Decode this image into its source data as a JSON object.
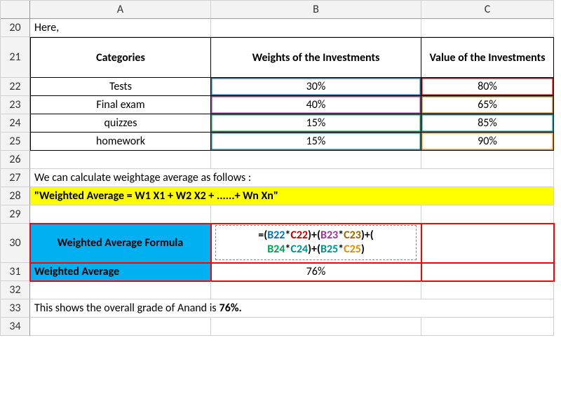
{
  "cols": [
    "",
    "A",
    "B",
    "C"
  ],
  "rows": [
    "20",
    "21",
    "22",
    "23",
    "24",
    "25",
    "26",
    "27",
    "28",
    "29",
    "30",
    "31",
    "32",
    "33",
    "34"
  ],
  "r20": {
    "a": "Here,"
  },
  "r21": {
    "a": "Categories",
    "b": "Weights of the Investments",
    "c": "Value of the Investments"
  },
  "data_rows": [
    {
      "cat": "Tests",
      "w": "30%",
      "v": "80%"
    },
    {
      "cat": "Final exam",
      "w": "40%",
      "v": "65%"
    },
    {
      "cat": "quizzes",
      "w": "15%",
      "v": "85%"
    },
    {
      "cat": "homework",
      "w": "15%",
      "v": "90%"
    }
  ],
  "r27": {
    "a": "We can calculate weightage average as follows :"
  },
  "r28": {
    "a": "\"Weighted Average = W1 X1 + W2 X2 + ......+ Wn Xn\""
  },
  "r30": {
    "a": "Weighted Average Formula"
  },
  "formula": {
    "p1": "=(",
    "b22": "B22",
    "s1": "*",
    "c22": "C22",
    "p2": ")+(",
    "b23": "B23",
    "s2": "*",
    "c23": "C23",
    "p3": ")+(",
    "b24": "B24",
    "s3": "*",
    "c24": "C24",
    "p4": ")+(",
    "b25": "B25",
    "s4": "*",
    "c25": "C25",
    "p5": ")"
  },
  "r31": {
    "a": "Weighted Average",
    "b": "76%"
  },
  "r33": {
    "pre": "This shows the overall grade of Anand is ",
    "bold": "76%.",
    "post": ""
  },
  "chart_data": {
    "type": "table",
    "title": "Weighted Average Calculation",
    "categories": [
      "Tests",
      "Final exam",
      "quizzes",
      "homework"
    ],
    "series": [
      {
        "name": "Weights of the Investments",
        "values": [
          0.3,
          0.4,
          0.15,
          0.15
        ]
      },
      {
        "name": "Value of the Investments",
        "values": [
          0.8,
          0.65,
          0.85,
          0.9
        ]
      }
    ],
    "result": {
      "label": "Weighted Average",
      "value": 0.76
    },
    "formula": "=(B22*C22)+(B23*C23)+(B24*C24)+(B25*C25)"
  }
}
